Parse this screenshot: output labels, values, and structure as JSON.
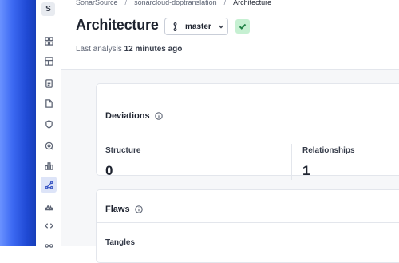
{
  "sidebar": {
    "avatar_letter": "S",
    "items": [
      {
        "icon": "grid-icon"
      },
      {
        "icon": "layout-icon"
      },
      {
        "icon": "document-icon"
      },
      {
        "icon": "file-icon"
      },
      {
        "icon": "shield-icon"
      },
      {
        "icon": "security-hotspot-icon"
      },
      {
        "icon": "bar-chart-icon"
      },
      {
        "icon": "architecture-icon",
        "active": true
      },
      {
        "icon": "activity-icon"
      },
      {
        "icon": "code-icon"
      },
      {
        "icon": "more-icon"
      }
    ]
  },
  "breadcrumb": {
    "org": "SonarSource",
    "project": "sonarcloud-doptranslation",
    "current": "Architecture",
    "separator": "/"
  },
  "header": {
    "title": "Architecture",
    "branch": "master",
    "quality_gate": "passed",
    "last_analysis_prefix": "Last analysis",
    "last_analysis_time": "12 minutes ago"
  },
  "deviations": {
    "title": "Deviations",
    "metrics": [
      {
        "label": "Structure",
        "value": "0"
      },
      {
        "label": "Relationships",
        "value": "1"
      }
    ]
  },
  "flaws": {
    "title": "Flaws",
    "first_metric_label": "Tangles"
  },
  "colors": {
    "accent": "#3b57c4",
    "quality_gate_passed_bg": "#c6f0d2",
    "quality_gate_passed_fg": "#1e7f44"
  }
}
